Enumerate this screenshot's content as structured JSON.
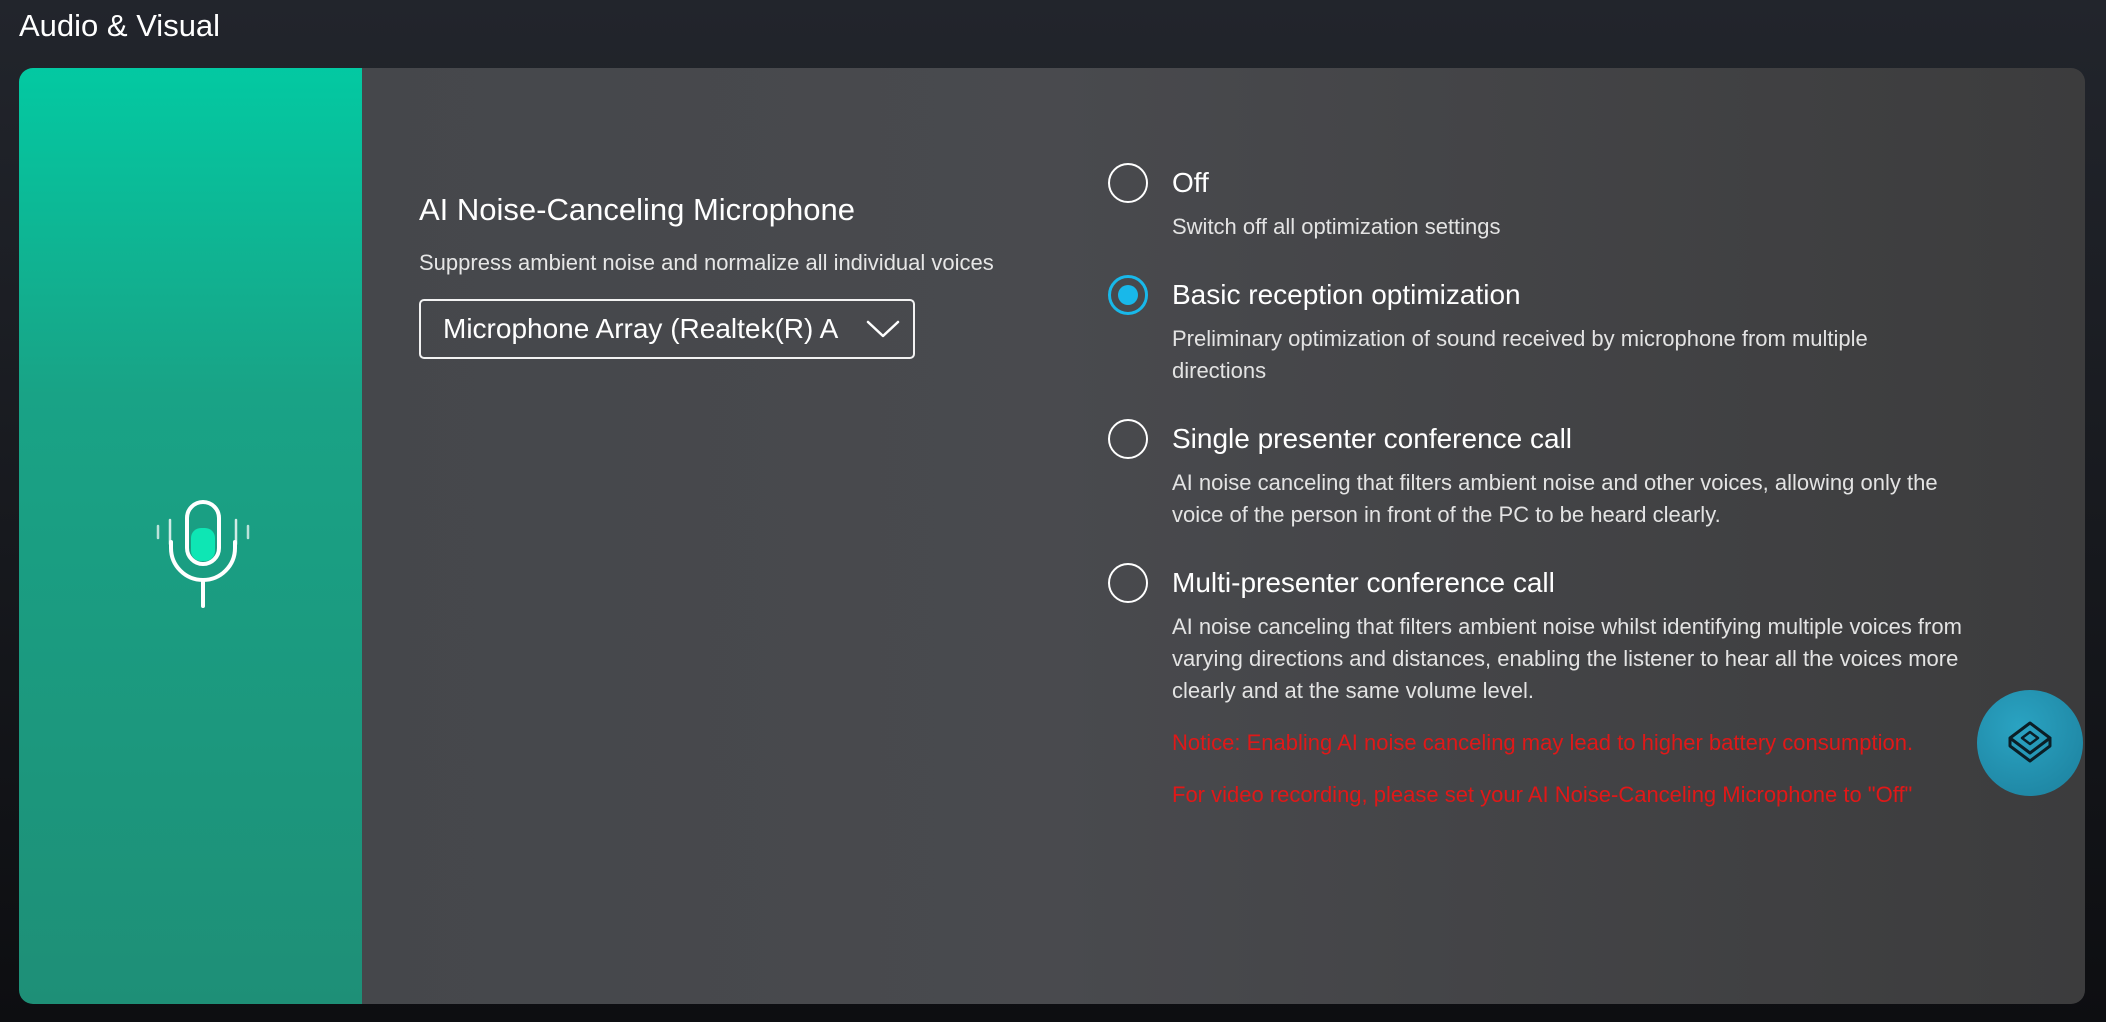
{
  "header": {
    "title": "Audio & Visual"
  },
  "noise_canceling": {
    "title": "AI Noise-Canceling Microphone",
    "description": "Suppress ambient noise and normalize all individual voices",
    "device_select": {
      "value": "Microphone Array (Realtek(R) A"
    }
  },
  "options": [
    {
      "label": "Off",
      "description": "Switch off all optimization settings",
      "checked": false
    },
    {
      "label": "Basic reception optimization",
      "description": "Preliminary optimization of sound received by microphone from multiple directions",
      "checked": true
    },
    {
      "label": "Single presenter conference call",
      "description": "AI noise canceling that filters ambient noise and other voices, allowing only the voice of the person in front of the PC to be heard clearly.",
      "checked": false
    },
    {
      "label": "Multi-presenter conference call",
      "description": "AI noise canceling that filters ambient noise whilst identifying multiple voices from varying directions and distances, enabling the listener to hear all the voices more clearly and at the same volume level.",
      "checked": false
    }
  ],
  "notices": [
    "Notice: Enabling AI noise canceling may lead to higher battery consumption.",
    "For video recording, please set your AI Noise-Canceling Microphone to \"Off\""
  ],
  "icons": {
    "panel_icon": "microphone-icon",
    "select_chevron": "chevron-down-icon",
    "fab_icon": "cube-icon"
  },
  "colors": {
    "accent": "#18b8ea",
    "panel_green": "#03c9a2",
    "notice_red": "#e01818"
  }
}
